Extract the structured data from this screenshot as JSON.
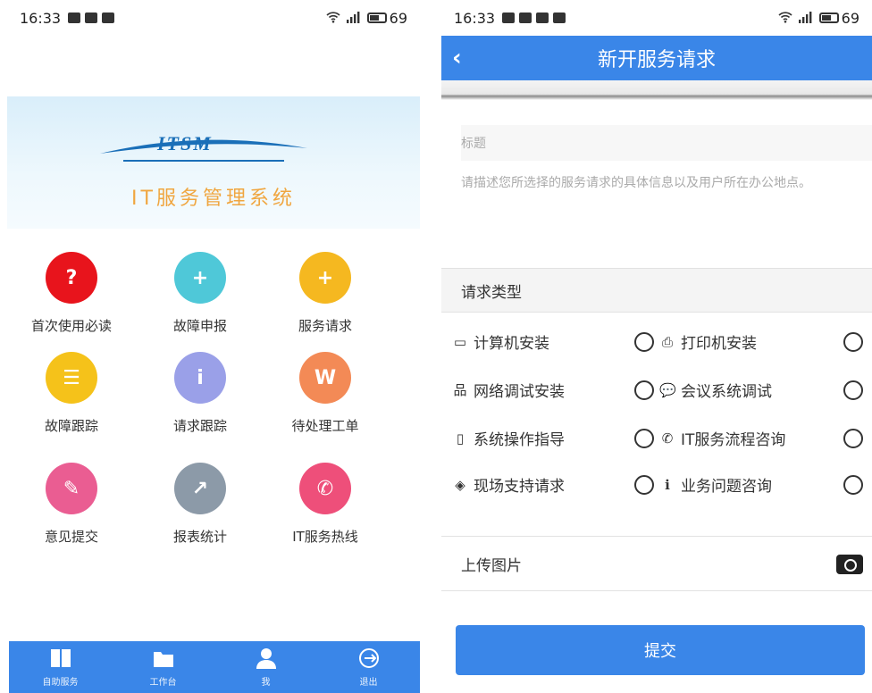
{
  "left": {
    "status": {
      "time": "16:33",
      "battery": "69"
    },
    "banner": {
      "logo": "ITSM",
      "title": "IT服务管理系统"
    },
    "grid": [
      {
        "label": "首次使用必读",
        "icon": "question-icon",
        "glyph": "?",
        "color": "#e8141c"
      },
      {
        "label": "故障申报",
        "icon": "plus-icon",
        "glyph": "+",
        "color": "#4fc8d8"
      },
      {
        "label": "服务请求",
        "icon": "plus-icon",
        "glyph": "+",
        "color": "#f5b820"
      },
      {
        "label": "故障跟踪",
        "icon": "list-icon",
        "glyph": "☰",
        "color": "#f5c21a"
      },
      {
        "label": "请求跟踪",
        "icon": "info-icon",
        "glyph": "i",
        "color": "#9aa0e8"
      },
      {
        "label": "待处理工单",
        "icon": "document-icon",
        "glyph": "W",
        "color": "#f38a56"
      },
      {
        "label": "意见提交",
        "icon": "pencil-icon",
        "glyph": "✎",
        "color": "#ea5d92"
      },
      {
        "label": "报表统计",
        "icon": "chart-icon",
        "glyph": "↗",
        "color": "#8c9aa8"
      },
      {
        "label": "IT服务热线",
        "icon": "phone-icon",
        "glyph": "✆",
        "color": "#ee4f7a"
      }
    ],
    "tabs": [
      {
        "label": "自助服务",
        "icon": "book-icon"
      },
      {
        "label": "工作台",
        "icon": "folder-icon"
      },
      {
        "label": "我",
        "icon": "user-icon"
      },
      {
        "label": "退出",
        "icon": "logout-icon"
      }
    ]
  },
  "right": {
    "status": {
      "time": "16:33",
      "battery": "69"
    },
    "nav": {
      "back": "‹",
      "title": "新开服务请求"
    },
    "form": {
      "title_placeholder": "标题",
      "desc_placeholder": "请描述您所选择的服务请求的具体信息以及用户所在办公地点。"
    },
    "request_type_label": "请求类型",
    "options": [
      {
        "label": "计算机安装",
        "icon": "monitor-icon",
        "glyph": "▭"
      },
      {
        "label": "打印机安装",
        "icon": "printer-icon",
        "glyph": "⎙"
      },
      {
        "label": "网络调试安装",
        "icon": "network-icon",
        "glyph": "品"
      },
      {
        "label": "会议系统调试",
        "icon": "chat-icon",
        "glyph": "💬"
      },
      {
        "label": "系统操作指导",
        "icon": "mobile-icon",
        "glyph": "▯"
      },
      {
        "label": "IT服务流程咨询",
        "icon": "phone-icon",
        "glyph": "✆"
      },
      {
        "label": "现场支持请求",
        "icon": "cube-icon",
        "glyph": "◈"
      },
      {
        "label": "业务问题咨询",
        "icon": "info-icon",
        "glyph": "ℹ"
      }
    ],
    "upload_label": "上传图片",
    "submit_label": "提交"
  }
}
